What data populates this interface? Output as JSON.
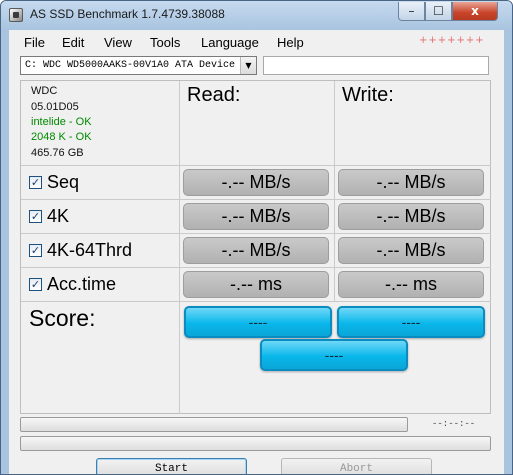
{
  "window": {
    "title": "AS SSD Benchmark 1.7.4739.38088",
    "close_glyph": "x",
    "min_glyph": "–",
    "max_glyph": "☐"
  },
  "menu": {
    "file": "File",
    "edit": "Edit",
    "view": "View",
    "tools": "Tools",
    "language": "Language",
    "help": "Help",
    "watermark": "+++++++"
  },
  "drive": {
    "selected": "C: WDC WD5000AAKS-00V1A0 ATA Device",
    "arrow": "▼",
    "aux_value": ""
  },
  "info": {
    "vendor": "WDC",
    "firmware": "05.01D05",
    "driver": "intelide - OK",
    "alignment": "2048 K - OK",
    "size": "465.76 GB"
  },
  "headers": {
    "read": "Read:",
    "write": "Write:"
  },
  "tests": [
    {
      "label": "Seq",
      "checked": true,
      "read": "-.-- MB/s",
      "write": "-.-- MB/s"
    },
    {
      "label": "4K",
      "checked": true,
      "read": "-.-- MB/s",
      "write": "-.-- MB/s"
    },
    {
      "label": "4K-64Thrd",
      "checked": true,
      "read": "-.-- MB/s",
      "write": "-.-- MB/s"
    },
    {
      "label": "Acc.time",
      "checked": true,
      "read": "-.-- ms",
      "write": "-.-- ms"
    }
  ],
  "check_glyph": "✓",
  "score": {
    "label": "Score:",
    "read": "----",
    "write": "----",
    "total": "----"
  },
  "progress": {
    "overall": 0,
    "test": 0,
    "elapsed": "--:--:--"
  },
  "buttons": {
    "start": "Start",
    "abort": "Abort"
  },
  "colors": {
    "score_accent": "#0ab7ea",
    "ok_text": "#008a00",
    "result_gray": "#b8b8b8"
  }
}
